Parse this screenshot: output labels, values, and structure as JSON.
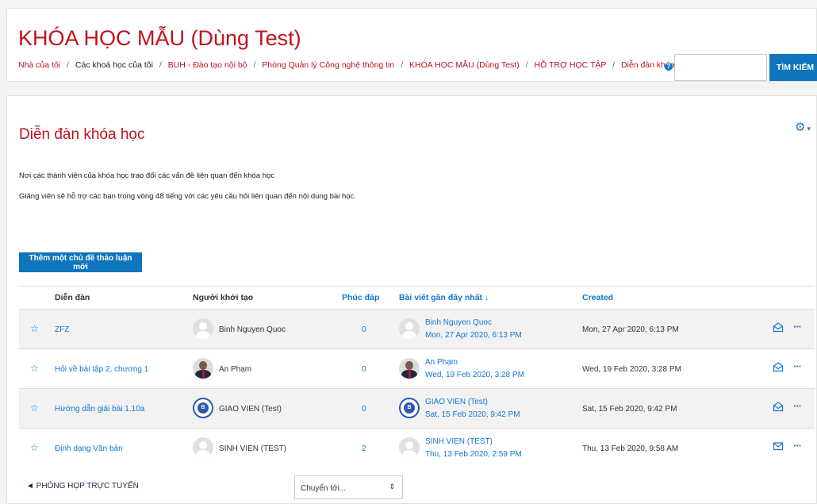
{
  "course": {
    "title": "KHÓA HỌC MẪU (Dùng Test)"
  },
  "breadcrumb": {
    "items": [
      "Nhà của tôi",
      "Các khoá học của tôi",
      "BUH - Đào tạo nội bộ",
      "Phòng Quản lý Công nghệ thông tin",
      "KHÓA HỌC MẪU (Dùng Test)",
      "HỖ TRỢ HỌC TẬP",
      "Diễn đàn khóa học"
    ],
    "separator": "/"
  },
  "search": {
    "help_label": "?",
    "value": "",
    "button_label": "TÌM KIẾM"
  },
  "forum": {
    "title": "Diễn đàn khóa học",
    "intro_1": "Nơi các thành viên của khóa học trao đổi các vấn đề liên quan đến khóa học",
    "intro_2": "Giảng viên sẽ hỗ trợ các bạn trong vòng 48 tiếng với các yêu cầu hỏi liên quan đến nội dung bài học.",
    "add_button": "Thêm một chủ đề thảo luận mới",
    "settings_icon": "gear-icon"
  },
  "table": {
    "headers": {
      "discussion": "Diễn đàn",
      "started_by": "Người khởi tạo",
      "replies": "Phúc đáp",
      "last_post": "Bài viết gần đây nhất ↓",
      "created": "Created"
    },
    "rows": [
      {
        "topic": "ZFZ",
        "starter": "Binh Nguyen Quoc",
        "starter_avatar": "default",
        "replies": "0",
        "last_author": "Binh Nguyen Quoc",
        "last_date": "Mon, 27 Apr 2020, 6:13 PM",
        "last_avatar": "default",
        "created": "Mon, 27 Apr 2020, 6:13 PM",
        "subscribed": false
      },
      {
        "topic": "Hỏi về bài tập 2, chương 1",
        "starter": "An Phạm",
        "starter_avatar": "photo",
        "replies": "0",
        "last_author": "An Phạm",
        "last_date": "Wed, 19 Feb 2020, 3:28 PM",
        "last_avatar": "photo",
        "created": "Wed, 19 Feb 2020, 3:28 PM",
        "subscribed": false
      },
      {
        "topic": "Hướng dẫn giải bài 1.10a",
        "starter": "GIAO VIEN (Test)",
        "starter_avatar": "logo",
        "replies": "0",
        "last_author": "GIAO VIEN (Test)",
        "last_date": "Sat, 15 Feb 2020, 9:42 PM",
        "last_avatar": "logo",
        "created": "Sat, 15 Feb 2020, 9:42 PM",
        "subscribed": false
      },
      {
        "topic": "Định dạng Văn bản",
        "starter": "SINH VIEN (TEST)",
        "starter_avatar": "default",
        "replies": "2",
        "last_author": "SINH VIEN (TEST)",
        "last_date": "Thu, 13 Feb 2020, 2:59 PM",
        "last_avatar": "default",
        "created": "Thu, 13 Feb 2020, 9:58 AM",
        "subscribed": true
      }
    ]
  },
  "footer": {
    "prev_activity": "◄ PHÒNG HỌP TRỰC TUYẾN",
    "jump_to": "Chuyển tới...",
    "jump_arrow": "⇕"
  },
  "colors": {
    "brand_red": "#c1121f",
    "link_blue": "#1177d1",
    "button_blue": "#0f75bc"
  }
}
